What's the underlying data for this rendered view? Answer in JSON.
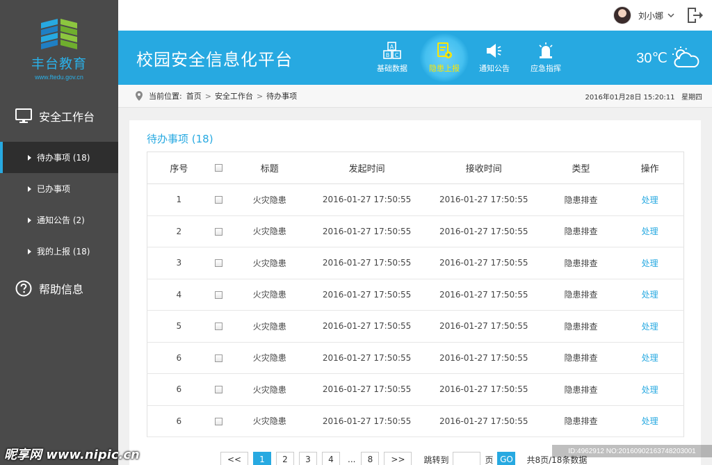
{
  "sidebar": {
    "logo_text": "丰台教育",
    "logo_url": "www.ftedu.gov.cn",
    "section_workbench": "安全工作台",
    "items": [
      {
        "label": "待办事项 (18)"
      },
      {
        "label": "已办事项"
      },
      {
        "label": "通知公告 (2)"
      },
      {
        "label": "我的上报 (18)"
      }
    ],
    "section_help": "帮助信息"
  },
  "userbar": {
    "username": "刘小娜"
  },
  "header": {
    "title": "校园安全信息化平台",
    "nav": [
      {
        "label": "基础数据",
        "icon": "abc-blocks-icon"
      },
      {
        "label": "隐患上报",
        "icon": "report-icon"
      },
      {
        "label": "通知公告",
        "icon": "megaphone-icon"
      },
      {
        "label": "应急指挥",
        "icon": "alarm-light-icon"
      }
    ],
    "temperature": "30℃",
    "weather_icon": "cloud-sun-icon",
    "accent_color": "#27a9e1",
    "active_color": "#ffe600"
  },
  "breadcrumb": {
    "prefix": "当前位置:",
    "items": [
      "首页",
      "安全工作台",
      "待办事项"
    ],
    "datetime": "2016年01月28日  15:20:11",
    "weekday": "星期四"
  },
  "main": {
    "title": "待办事项 (18)",
    "columns": [
      "序号",
      "",
      "标题",
      "发起时间",
      "接收时间",
      "类型",
      "操作"
    ],
    "rows": [
      {
        "no": "1",
        "title": "火灾隐患",
        "start": "2016-01-27 17:50:55",
        "recv": "2016-01-27 17:50:55",
        "type": "隐患排查",
        "action": "处理"
      },
      {
        "no": "2",
        "title": "火灾隐患",
        "start": "2016-01-27 17:50:55",
        "recv": "2016-01-27 17:50:55",
        "type": "隐患排查",
        "action": "处理"
      },
      {
        "no": "3",
        "title": "火灾隐患",
        "start": "2016-01-27 17:50:55",
        "recv": "2016-01-27 17:50:55",
        "type": "隐患排查",
        "action": "处理"
      },
      {
        "no": "4",
        "title": "火灾隐患",
        "start": "2016-01-27 17:50:55",
        "recv": "2016-01-27 17:50:55",
        "type": "隐患排查",
        "action": "处理"
      },
      {
        "no": "5",
        "title": "火灾隐患",
        "start": "2016-01-27 17:50:55",
        "recv": "2016-01-27 17:50:55",
        "type": "隐患排查",
        "action": "处理"
      },
      {
        "no": "6",
        "title": "火灾隐患",
        "start": "2016-01-27 17:50:55",
        "recv": "2016-01-27 17:50:55",
        "type": "隐患排查",
        "action": "处理"
      },
      {
        "no": "6",
        "title": "火灾隐患",
        "start": "2016-01-27 17:50:55",
        "recv": "2016-01-27 17:50:55",
        "type": "隐患排查",
        "action": "处理"
      },
      {
        "no": "6",
        "title": "火灾隐患",
        "start": "2016-01-27 17:50:55",
        "recv": "2016-01-27 17:50:55",
        "type": "隐患排查",
        "action": "处理"
      }
    ]
  },
  "pager": {
    "prev": "<<",
    "pages": [
      "1",
      "2",
      "3",
      "4"
    ],
    "dots": "...",
    "last": "8",
    "next": ">>",
    "jump_label": "跳转到",
    "page_unit": "页",
    "go": "GO",
    "total": "共8页/18条数据"
  },
  "watermark": {
    "left": "昵享网 www.nipic.cn",
    "right": "ID:4962912 NO:20160902163748203001"
  }
}
